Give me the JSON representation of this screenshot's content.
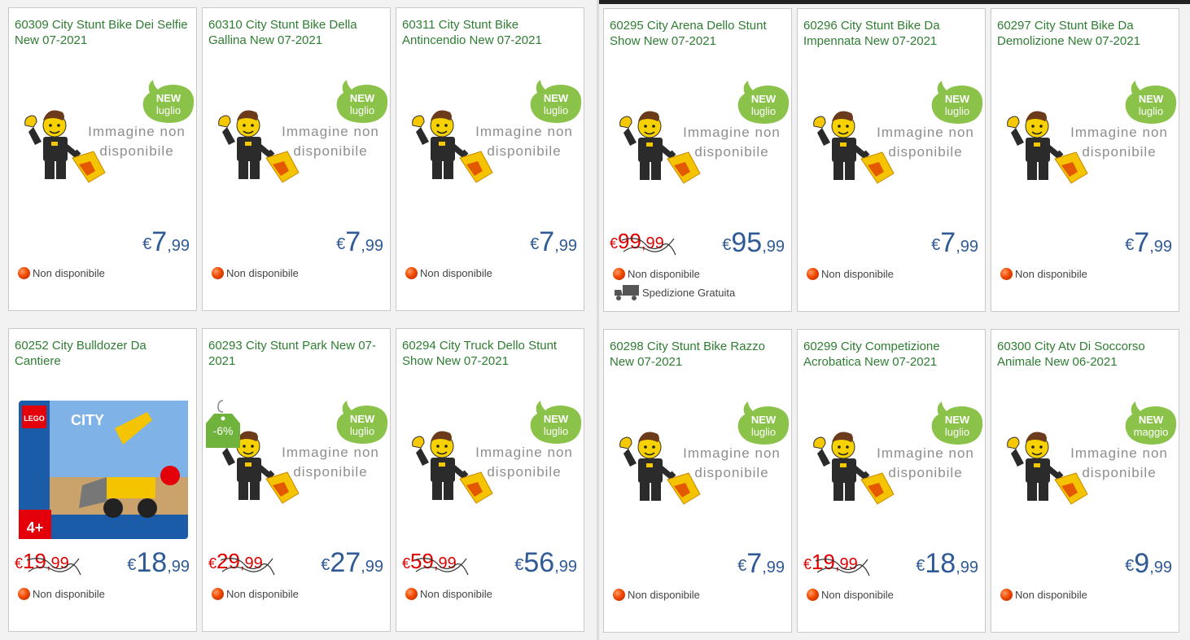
{
  "colors": {
    "title": "#2e7d32",
    "price": "#2f5a96",
    "old_price": "#e00000",
    "badge": "#8bc34a",
    "status_dot": "#f04a00"
  },
  "placeholder_image": {
    "line1": "Immagine non",
    "line2": "disponibile",
    "icon": "lego-minifigure-with-sign-icon"
  },
  "panes": [
    {
      "products": [
        {
          "title": "60309 City Stunt Bike Dei Selfie New 07-2021",
          "badge_line1": "NEW",
          "badge_line2": "luglio",
          "currency": "€",
          "price_int": "7",
          "price_cents": ",99",
          "status": "Non disponibile"
        },
        {
          "title": "60310 City Stunt Bike Della Gallina New 07-2021",
          "badge_line1": "NEW",
          "badge_line2": "luglio",
          "currency": "€",
          "price_int": "7",
          "price_cents": ",99",
          "status": "Non disponibile"
        },
        {
          "title": "60311 City Stunt Bike Antincendio New 07-2021",
          "badge_line1": "NEW",
          "badge_line2": "luglio",
          "currency": "€",
          "price_int": "7",
          "price_cents": ",99",
          "status": "Non disponibile"
        },
        {
          "title": "60252 City Bulldozer Da Cantiere",
          "image": "lego-city-bulldozer-box",
          "old_int": "19",
          "old_cents": ",99",
          "currency": "€",
          "price_int": "18",
          "price_cents": ",99",
          "status": "Non disponibile",
          "box_brand": "LEGO",
          "box_line": "CITY",
          "box_age": "4+"
        },
        {
          "title": "60293 City Stunt Park New 07-2021",
          "badge_line1": "NEW",
          "badge_line2": "luglio",
          "discount": "-6%",
          "old_int": "29",
          "old_cents": ",99",
          "currency": "€",
          "price_int": "27",
          "price_cents": ",99",
          "status": "Non disponibile"
        },
        {
          "title": "60294 City Truck Dello Stunt Show New 07-2021",
          "badge_line1": "NEW",
          "badge_line2": "luglio",
          "old_int": "59",
          "old_cents": ",99",
          "currency": "€",
          "price_int": "56",
          "price_cents": ",99",
          "status": "Non disponibile"
        }
      ]
    },
    {
      "products": [
        {
          "title": "60295 City Arena Dello Stunt Show New 07-2021",
          "badge_line1": "NEW",
          "badge_line2": "luglio",
          "old_int": "99",
          "old_cents": ",99",
          "currency": "€",
          "price_int": "95",
          "price_cents": ",99",
          "status": "Non disponibile",
          "shipping": "Spedizione Gratuita"
        },
        {
          "title": "60296 City Stunt Bike Da Impennata New 07-2021",
          "badge_line1": "NEW",
          "badge_line2": "luglio",
          "currency": "€",
          "price_int": "7",
          "price_cents": ",99",
          "status": "Non disponibile"
        },
        {
          "title": "60297 City Stunt Bike Da Demolizione New 07-2021",
          "badge_line1": "NEW",
          "badge_line2": "luglio",
          "currency": "€",
          "price_int": "7",
          "price_cents": ",99",
          "status": "Non disponibile"
        },
        {
          "title": "60298 City Stunt Bike Razzo New 07-2021",
          "badge_line1": "NEW",
          "badge_line2": "luglio",
          "currency": "€",
          "price_int": "7",
          "price_cents": ",99",
          "status": "Non disponibile"
        },
        {
          "title": "60299 City Competizione Acrobatica New 07-2021",
          "badge_line1": "NEW",
          "badge_line2": "luglio",
          "old_int": "19",
          "old_cents": ",99",
          "currency": "€",
          "price_int": "18",
          "price_cents": ",99",
          "status": "Non disponibile"
        },
        {
          "title": "60300 City Atv Di Soccorso Animale New 06-2021",
          "badge_line1": "NEW",
          "badge_line2": "maggio",
          "currency": "€",
          "price_int": "9",
          "price_cents": ",99",
          "status": "Non disponibile"
        }
      ]
    }
  ]
}
